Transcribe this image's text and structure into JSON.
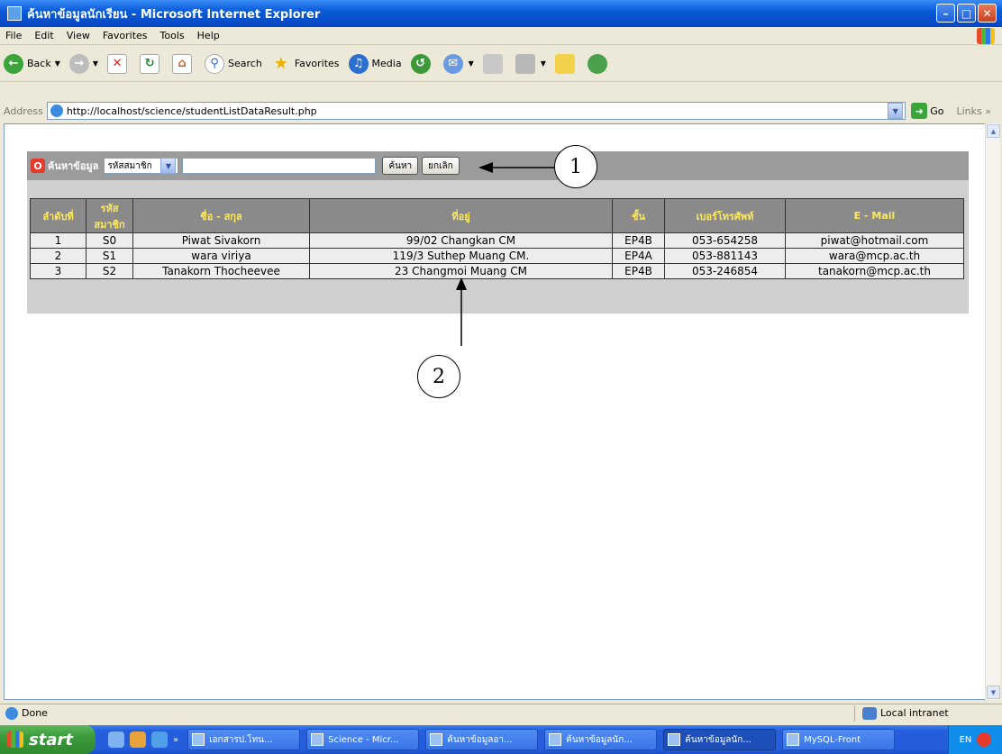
{
  "window": {
    "title": "ค้นหาข้อมูลนักเรียน - Microsoft Internet Explorer"
  },
  "menu": [
    "File",
    "Edit",
    "View",
    "Favorites",
    "Tools",
    "Help"
  ],
  "toolbar": {
    "back": "Back",
    "search": "Search",
    "favorites": "Favorites",
    "media": "Media"
  },
  "address": {
    "label": "Address",
    "url": "http://localhost/science/studentListDataResult.php",
    "go": "Go",
    "links": "Links"
  },
  "search_panel": {
    "label": "ค้นหาข้อมูล",
    "select_value": "รหัสสมาชิก",
    "input_value": "",
    "search_button": "ค้นหา",
    "cancel_button": "ยกเลิก"
  },
  "table": {
    "headers": [
      "ลำดับที่",
      "รหัส สมาชิก",
      "ชื่อ - สกุล",
      "ที่อยู่",
      "ชั้น",
      "เบอร์โทรศัพท์",
      "E - Mail"
    ],
    "rows": [
      [
        "1",
        "S0",
        "Piwat  Sivakorn",
        "99/02 Changkan CM",
        "EP4B",
        "053-654258",
        "piwat@hotmail.com"
      ],
      [
        "2",
        "S1",
        "wara  viriya",
        "119/3 Suthep Muang CM.",
        "EP4A",
        "053-881143",
        "wara@mcp.ac.th"
      ],
      [
        "3",
        "S2",
        "Tanakorn  Thocheevee",
        "23 Changmoi Muang CM",
        "EP4B",
        "053-246854",
        "tanakorn@mcp.ac.th"
      ]
    ]
  },
  "callouts": [
    "1",
    "2"
  ],
  "status": {
    "text": "Done",
    "zone": "Local intranet"
  },
  "taskbar": {
    "start": "start",
    "tasks": [
      "เอกสารป.โทน...",
      "Science - Micr...",
      "ค้นหาข้อมูลอา...",
      "ค้นหาข้อมูลนัก...",
      "ค้นหาข้อมูลนัก...",
      "MySQL-Front"
    ],
    "tray_lang": "EN"
  }
}
